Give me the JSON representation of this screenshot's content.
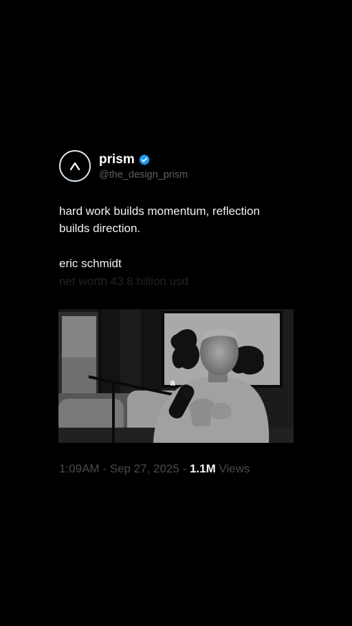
{
  "profile": {
    "display_name": "prism",
    "handle": "@the_design_prism",
    "avatar_icon": "chevron-up-icon",
    "verified_icon": "verified-badge-icon",
    "verified_color": "#1d9bf0"
  },
  "post": {
    "text": "hard work builds momentum, reflection builds direction.",
    "author": "eric schmidt",
    "subtitle": "net worth 43.8 billion usd"
  },
  "media": {
    "caption_letter": "a"
  },
  "meta": {
    "time": "1:09AM",
    "separator": " - ",
    "date": "Sep 27, 2025",
    "views_count": "1.1M",
    "views_label": "Views"
  }
}
